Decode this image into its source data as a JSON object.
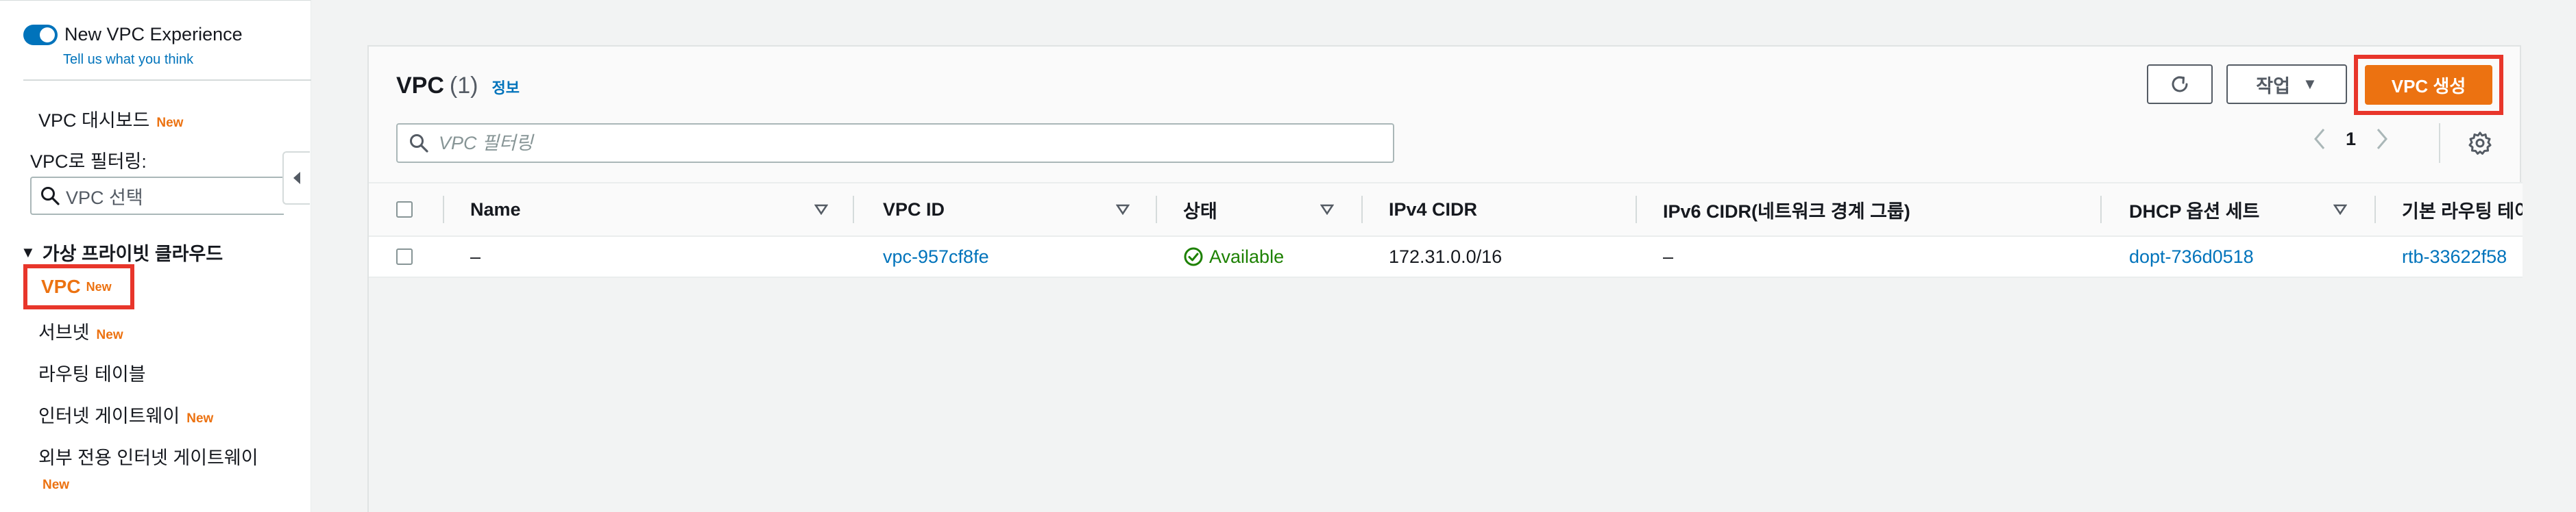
{
  "sidebar": {
    "toggle_label": "New VPC Experience",
    "feedback_link": "Tell us what you think",
    "dashboard": "VPC 대시보드",
    "new_badge": "New",
    "filter_label": "VPC로 필터링:",
    "filter_placeholder": "VPC 선택",
    "section_title": "가상 프라이빗 클라우드",
    "items": [
      {
        "label": "VPC",
        "new": "New",
        "active": true
      },
      {
        "label": "서브넷",
        "new": "New"
      },
      {
        "label": "라우팅 테이블",
        "new": ""
      },
      {
        "label": "인터넷 게이트웨이",
        "new": "New"
      },
      {
        "label": "외부 전용 인터넷 게이트웨이",
        "new": "New"
      }
    ]
  },
  "panel": {
    "title": "VPC",
    "count": "(1)",
    "info": "정보",
    "actions_label": "작업",
    "create_label": "VPC 생성",
    "search_placeholder": "VPC 필터링",
    "page_number": "1"
  },
  "table": {
    "columns": [
      "Name",
      "VPC ID",
      "상태",
      "IPv4 CIDR",
      "IPv6 CIDR(네트워크 경계 그룹)",
      "DHCP 옵션 세트",
      "기본 라우팅 테이"
    ],
    "rows": [
      {
        "name": "–",
        "vpc_id": "vpc-957cf8fe",
        "status": "Available",
        "ipv4": "172.31.0.0/16",
        "ipv6": "–",
        "dhcp": "dopt-736d0518",
        "route_table": "rtb-33622f58"
      }
    ]
  },
  "colors": {
    "accent": "#0073bb",
    "primary_button": "#ec7211",
    "highlight_box": "#e8362b",
    "status_green": "#1d8102"
  },
  "icons": [
    "search-icon",
    "refresh-icon",
    "caret-down-icon",
    "chevron-left-icon",
    "chevron-right-icon",
    "gear-icon",
    "sort-icon",
    "check-circle-icon",
    "collapse-icon"
  ]
}
